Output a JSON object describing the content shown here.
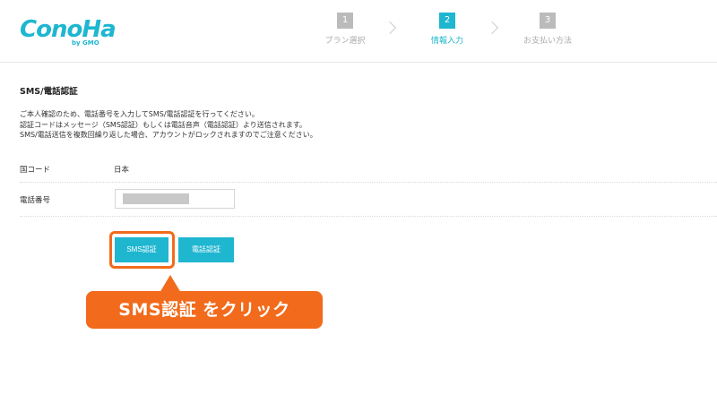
{
  "brand": {
    "logo_text": "ConoHa",
    "logo_sub": "by GMO"
  },
  "steps": [
    {
      "num": "1",
      "label": "プラン選択",
      "active": false
    },
    {
      "num": "2",
      "label": "情報入力",
      "active": true
    },
    {
      "num": "3",
      "label": "お支払い方法",
      "active": false
    }
  ],
  "section": {
    "title": "SMS/電話認証",
    "desc_lines": [
      "ご本人確認のため、電話番号を入力してSMS/電話認証を行ってください。",
      "認証コードはメッセージ（SMS認証）もしくは電話音声（電話認証）より送信されます。",
      "SMS/電話送信を複数回繰り返した場合、アカウントがロックされますのでご注意ください。"
    ]
  },
  "form": {
    "country_label": "国コード",
    "country_value": "日本",
    "phone_label": "電話番号",
    "phone_value": ""
  },
  "buttons": {
    "sms": "SMS認証",
    "tel": "電話認証"
  },
  "annotation": {
    "callout_text": "SMS認証 をクリック"
  },
  "colors": {
    "accent": "#1fb6d0",
    "highlight": "#f26a1b"
  }
}
